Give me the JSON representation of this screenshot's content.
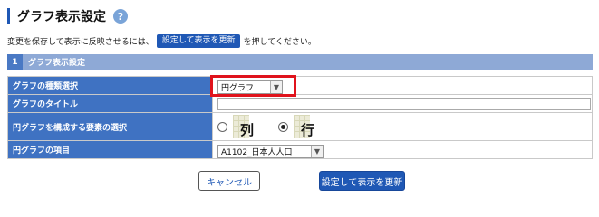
{
  "page": {
    "title": "グラフ表示設定",
    "help_icon_glyph": "?"
  },
  "instruction": {
    "before": "変更を保存して表示に反映させるには、",
    "button_label": "設定して表示を更新",
    "after": "を押してください。"
  },
  "section": {
    "number": "1",
    "label": "グラフ表示設定"
  },
  "form": {
    "chart_type": {
      "label": "グラフの種類選択",
      "value": "円グラフ"
    },
    "chart_title": {
      "label": "グラフのタイトル",
      "value": ""
    },
    "pie_elements": {
      "label": "円グラフを構成する要素の選択",
      "options": [
        {
          "glyph": "列",
          "checked": false
        },
        {
          "glyph": "行",
          "checked": true
        }
      ]
    },
    "pie_item": {
      "label": "円グラフの項目",
      "value": "A1102_日本人人口"
    }
  },
  "buttons": {
    "cancel": "キャンセル",
    "apply": "設定して表示を更新"
  },
  "colors": {
    "accent": "#1f58b5",
    "label_bg": "#3f72c2",
    "section_bg": "#8ea9d6",
    "highlight": "#e0131c"
  }
}
